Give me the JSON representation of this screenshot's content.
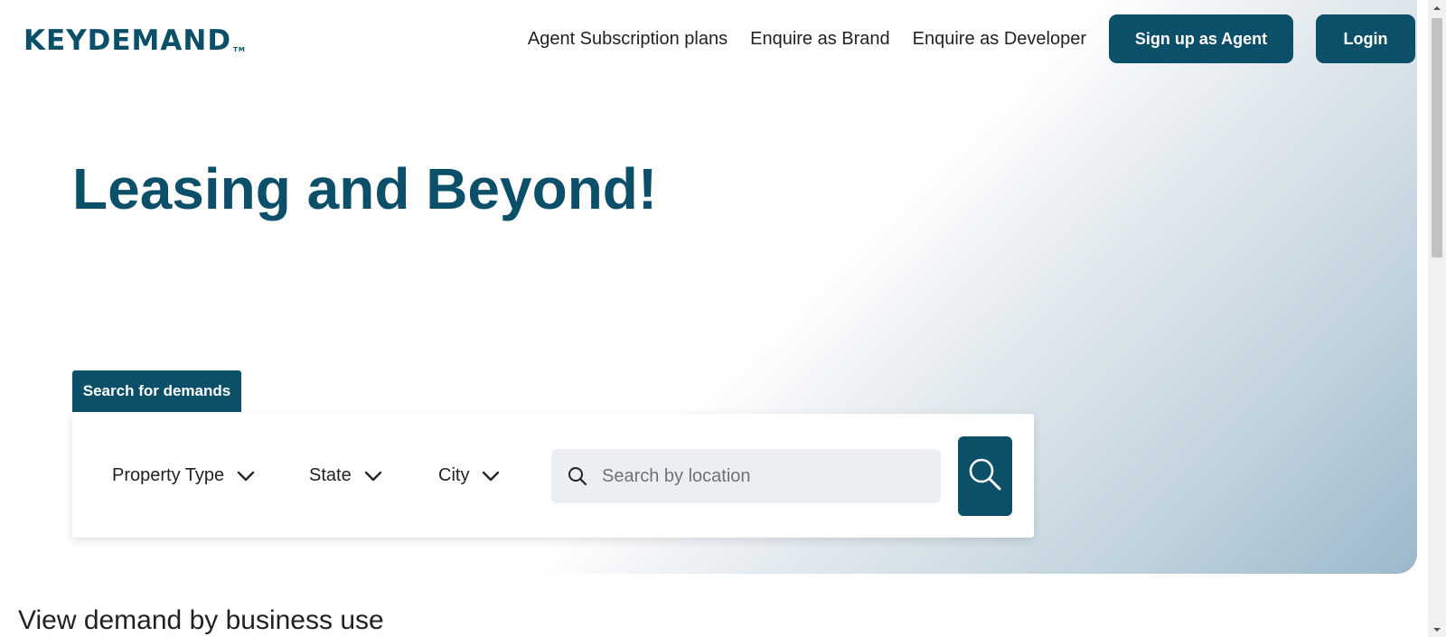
{
  "brand": {
    "name": "KEYDEMAND",
    "trademark": "TM"
  },
  "nav": {
    "links": [
      "Agent Subscription plans",
      "Enquire as Brand",
      "Enquire as Developer"
    ],
    "signup_label": "Sign up as Agent",
    "login_label": "Login"
  },
  "hero": {
    "title": "Leasing and Beyond!"
  },
  "search": {
    "tab_label": "Search for demands",
    "filters": {
      "property_type": "Property Type",
      "state": "State",
      "city": "City"
    },
    "placeholder": "Search by location"
  },
  "section": {
    "title": "View demand by business use"
  },
  "colors": {
    "brand": "#0b5068",
    "input_bg": "#ebeff3"
  }
}
